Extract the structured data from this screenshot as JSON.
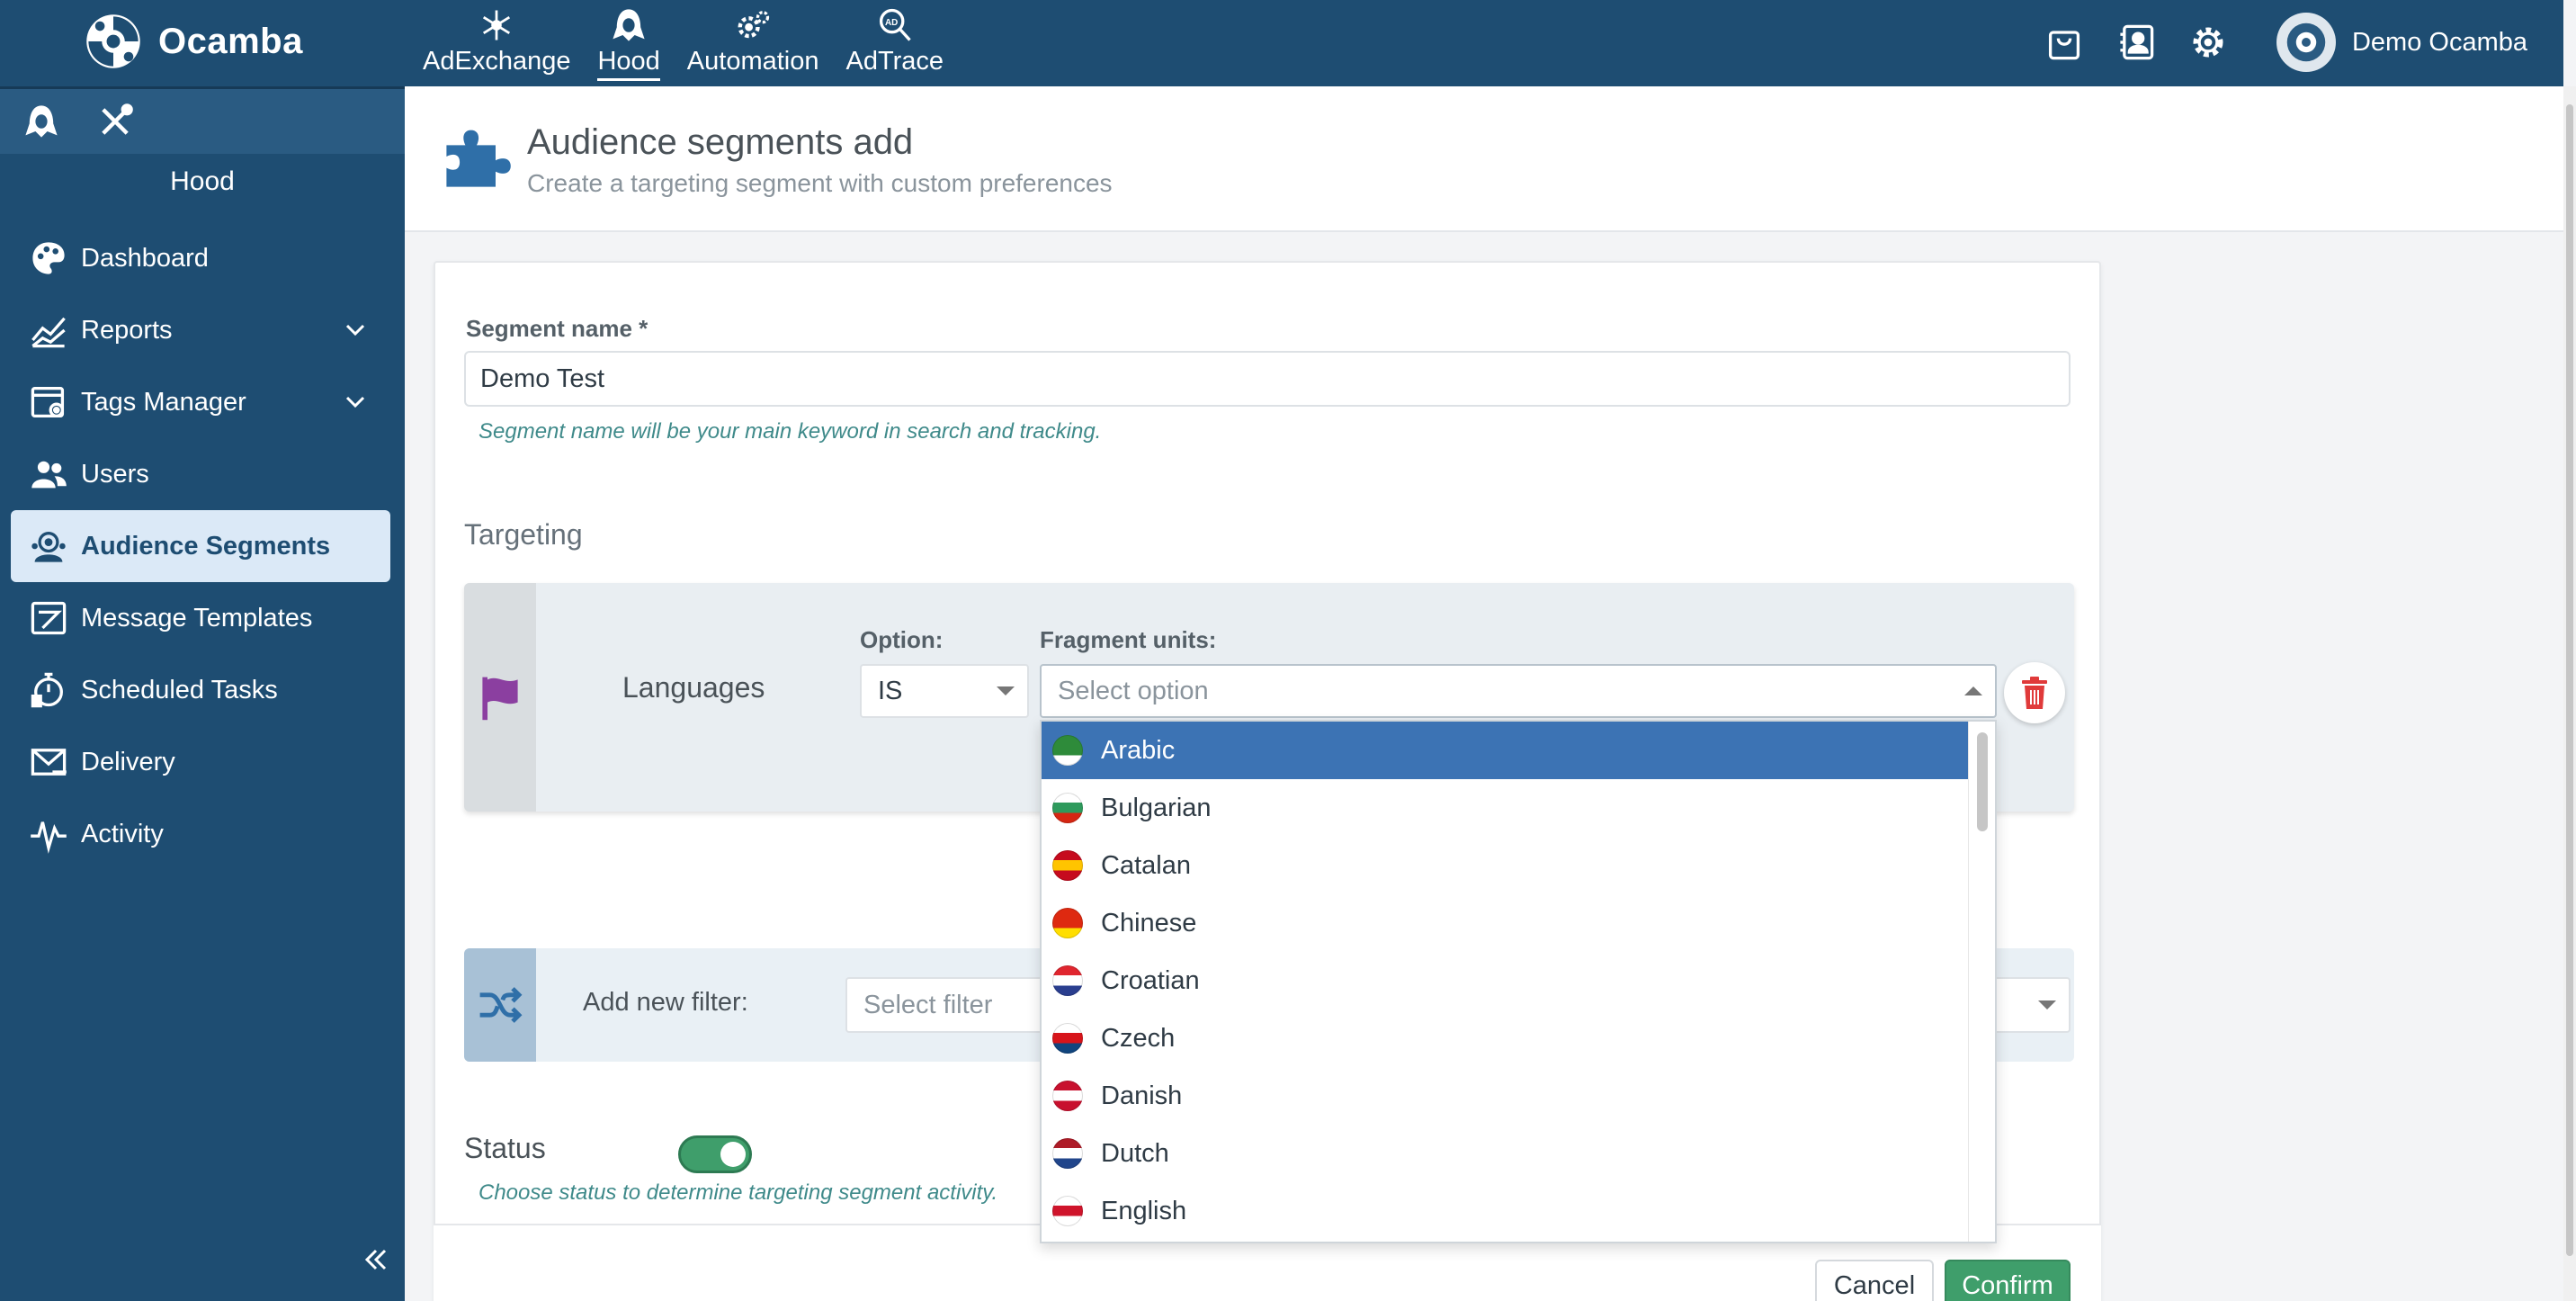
{
  "app": {
    "name": "Ocamba",
    "user": "Demo Ocamba"
  },
  "topnav": [
    {
      "label": "AdExchange",
      "icon": "snowflake-icon"
    },
    {
      "label": "Hood",
      "icon": "hood-icon",
      "active": true
    },
    {
      "label": "Automation",
      "icon": "gears-icon"
    },
    {
      "label": "AdTrace",
      "icon": "ad-search-icon"
    }
  ],
  "topright_icons": [
    "bag-icon",
    "contact-card-icon",
    "gear-icon"
  ],
  "sidebar": {
    "title": "Hood",
    "items": [
      {
        "label": "Dashboard",
        "icon": "palette-icon"
      },
      {
        "label": "Reports",
        "icon": "chart-line-icon",
        "expandable": true
      },
      {
        "label": "Tags Manager",
        "icon": "tag-window-icon",
        "expandable": true
      },
      {
        "label": "Users",
        "icon": "users-icon"
      },
      {
        "label": "Audience Segments",
        "icon": "audience-icon",
        "active": true
      },
      {
        "label": "Message Templates",
        "icon": "template-icon"
      },
      {
        "label": "Scheduled Tasks",
        "icon": "stopwatch-icon"
      },
      {
        "label": "Delivery",
        "icon": "envelope-icon"
      },
      {
        "label": "Activity",
        "icon": "pulse-icon"
      }
    ]
  },
  "page": {
    "title": "Audience segments add",
    "subtitle": "Create a targeting segment with custom preferences"
  },
  "form": {
    "segment_name_label": "Segment name *",
    "segment_name_value": "Demo Test",
    "segment_name_hint": "Segment name will be your main keyword in search and tracking.",
    "targeting_title": "Targeting",
    "filter": {
      "name": "Languages",
      "option_label": "Option:",
      "option_value": "IS",
      "fragment_label": "Fragment units:",
      "fragment_placeholder": "Select option"
    },
    "add_filter_label": "Add new filter:",
    "add_filter_placeholder": "Select filter",
    "status_label": "Status",
    "status_on": true,
    "status_hint": "Choose status to determine targeting segment activity."
  },
  "buttons": {
    "cancel": "Cancel",
    "confirm": "Confirm"
  },
  "dropdown_options": [
    {
      "label": "Arabic",
      "selected": true,
      "colors": [
        "#2e8b3a",
        "#2e8b3a",
        "#ffffff"
      ]
    },
    {
      "label": "Bulgarian",
      "colors": [
        "#ffffff",
        "#2e9a5c",
        "#d62612"
      ]
    },
    {
      "label": "Catalan",
      "colors": [
        "#c60b1e",
        "#ffc400",
        "#c60b1e"
      ]
    },
    {
      "label": "Chinese",
      "colors": [
        "#de2910",
        "#de2910",
        "#ffde00"
      ]
    },
    {
      "label": "Croatian",
      "colors": [
        "#e0262f",
        "#ffffff",
        "#2a3e8f"
      ]
    },
    {
      "label": "Czech",
      "colors": [
        "#ffffff",
        "#d7141a",
        "#11457e"
      ]
    },
    {
      "label": "Danish",
      "colors": [
        "#c8102e",
        "#ffffff",
        "#c8102e"
      ]
    },
    {
      "label": "Dutch",
      "colors": [
        "#ae1c28",
        "#ffffff",
        "#21468b"
      ]
    },
    {
      "label": "English",
      "colors": [
        "#ffffff",
        "#cf142b",
        "#ffffff"
      ]
    }
  ],
  "colors": {
    "topbar": "#1e4d72",
    "selected": "#3c73b4",
    "confirm": "#3f9e6b",
    "delete": "#e03a3a",
    "flag_icon": "#8b3fa0"
  }
}
